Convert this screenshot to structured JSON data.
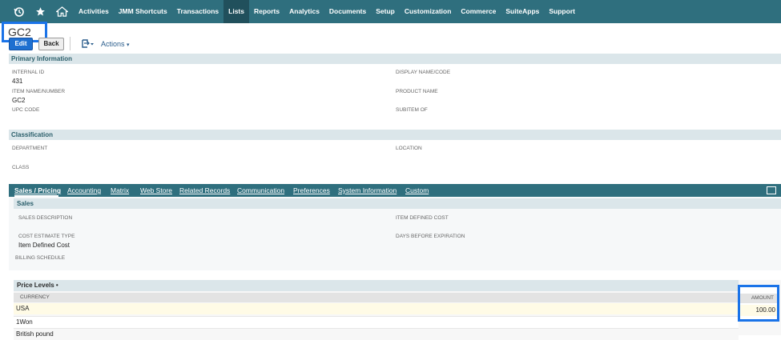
{
  "nav": {
    "items": [
      "Activities",
      "JMM Shortcuts",
      "Transactions",
      "Lists",
      "Reports",
      "Analytics",
      "Documents",
      "Setup",
      "Customization",
      "Commerce",
      "SuiteApps",
      "Support"
    ],
    "active": "Lists",
    "icons": [
      "recent-icon",
      "star-icon",
      "home-icon"
    ]
  },
  "record": {
    "title": "GC2",
    "edit_label": "Edit",
    "back_label": "Back",
    "actions_label": "Actions"
  },
  "primary": {
    "section_title": "Primary Information",
    "internal_id_label": "INTERNAL ID",
    "internal_id_value": "431",
    "display_name_label": "DISPLAY NAME/CODE",
    "item_name_label": "ITEM NAME/NUMBER",
    "item_name_value": "GC2",
    "product_name_label": "PRODUCT NAME",
    "upc_label": "UPC CODE",
    "subitem_label": "SUBITEM OF"
  },
  "classification": {
    "section_title": "Classification",
    "department_label": "DEPARTMENT",
    "location_label": "LOCATION",
    "class_label": "CLASS"
  },
  "subtabs": [
    "Sales / Pricing",
    "Accounting",
    "Matrix",
    "Web Store",
    "Related Records",
    "Communication",
    "Preferences",
    "System Information",
    "Custom"
  ],
  "sales": {
    "section_title": "Sales",
    "sales_desc_label": "SALES DESCRIPTION",
    "item_defined_cost_label": "ITEM DEFINED COST",
    "cost_estimate_type_label": "COST ESTIMATE TYPE",
    "cost_estimate_type_value": "Item Defined Cost",
    "days_before_expiration_label": "DAYS BEFORE EXPIRATION",
    "billing_schedule_label": "BILLING SCHEDULE"
  },
  "price_levels": {
    "title": "Price Levels •",
    "currency_header": "CURRENCY",
    "amount_header": "AMOUNT",
    "rows": [
      {
        "currency": "USA",
        "amount": "100.00"
      },
      {
        "currency": "1Won",
        "amount": ""
      },
      {
        "currency": "British pound",
        "amount": ""
      }
    ]
  }
}
